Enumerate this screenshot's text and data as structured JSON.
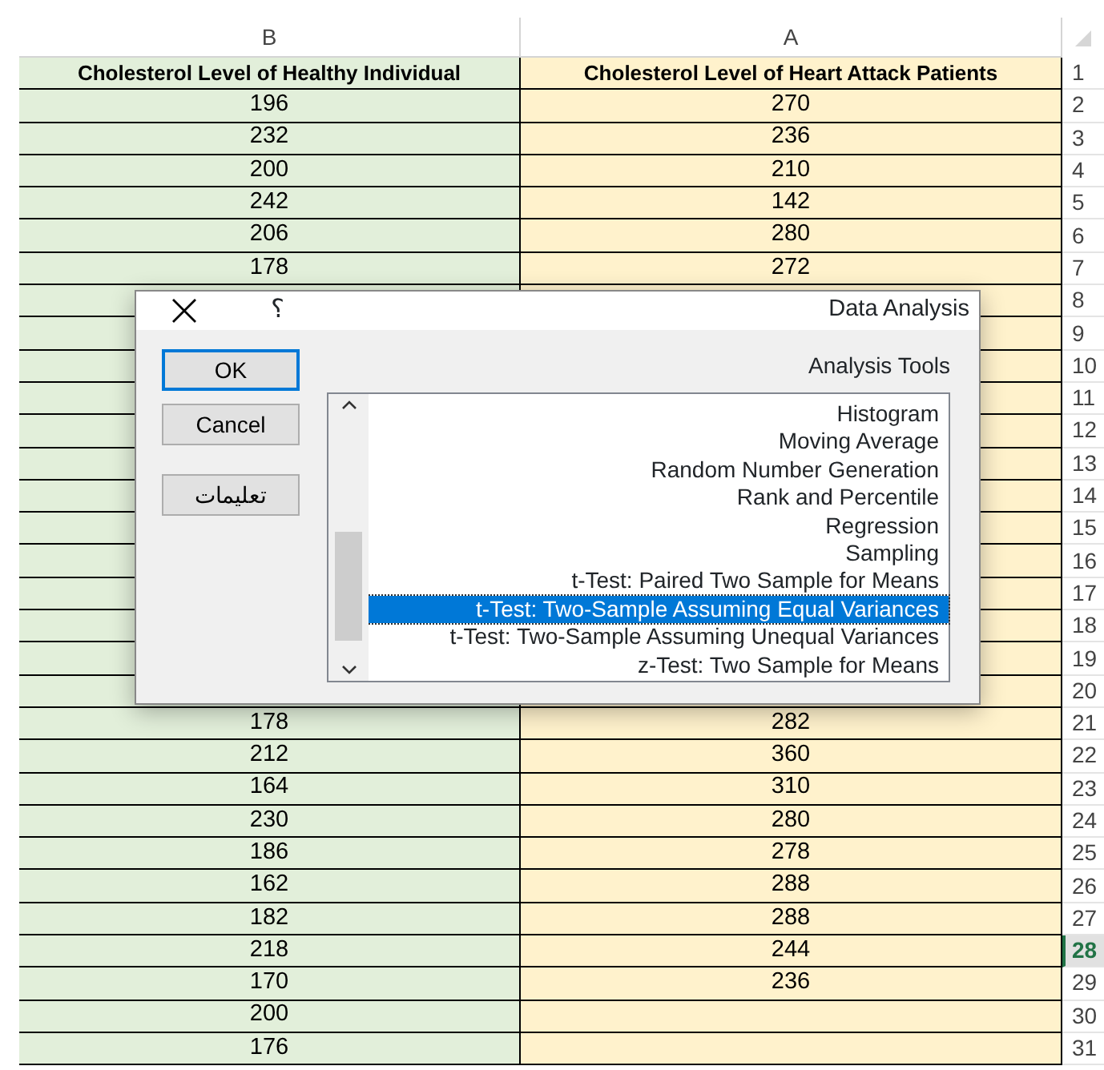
{
  "column_headers": [
    "B",
    "A"
  ],
  "rows": [
    {
      "number": "1",
      "kind": "header",
      "selected": false,
      "b": "Cholesterol Level of Healthy Individual",
      "a": "Cholesterol Level of Heart Attack Patients"
    },
    {
      "number": "2",
      "kind": "data",
      "selected": false,
      "b": "196",
      "a": "270"
    },
    {
      "number": "3",
      "kind": "data",
      "selected": false,
      "b": "232",
      "a": "236"
    },
    {
      "number": "4",
      "kind": "data",
      "selected": false,
      "b": "200",
      "a": "210"
    },
    {
      "number": "5",
      "kind": "data",
      "selected": false,
      "b": "242",
      "a": "142"
    },
    {
      "number": "6",
      "kind": "data",
      "selected": false,
      "b": "206",
      "a": "280"
    },
    {
      "number": "7",
      "kind": "data",
      "selected": false,
      "b": "178",
      "a": "272"
    },
    {
      "number": "8",
      "kind": "data",
      "selected": false
    },
    {
      "number": "9",
      "kind": "data",
      "selected": false
    },
    {
      "number": "10",
      "kind": "data",
      "selected": false
    },
    {
      "number": "11",
      "kind": "data",
      "selected": false
    },
    {
      "number": "12",
      "kind": "data",
      "selected": false
    },
    {
      "number": "13",
      "kind": "data",
      "selected": false
    },
    {
      "number": "14",
      "kind": "data",
      "selected": false
    },
    {
      "number": "15",
      "kind": "data",
      "selected": false
    },
    {
      "number": "16",
      "kind": "data",
      "selected": false
    },
    {
      "number": "17",
      "kind": "data",
      "selected": false
    },
    {
      "number": "18",
      "kind": "data",
      "selected": false
    },
    {
      "number": "19",
      "kind": "data",
      "selected": false
    },
    {
      "number": "20",
      "kind": "data",
      "selected": false
    },
    {
      "number": "21",
      "kind": "data",
      "selected": false,
      "b": "178",
      "a": "282"
    },
    {
      "number": "22",
      "kind": "data",
      "selected": false,
      "b": "212",
      "a": "360"
    },
    {
      "number": "23",
      "kind": "data",
      "selected": false,
      "b": "164",
      "a": "310"
    },
    {
      "number": "24",
      "kind": "data",
      "selected": false,
      "b": "230",
      "a": "280"
    },
    {
      "number": "25",
      "kind": "data",
      "selected": false,
      "b": "186",
      "a": "278"
    },
    {
      "number": "26",
      "kind": "data",
      "selected": false,
      "b": "162",
      "a": "288"
    },
    {
      "number": "27",
      "kind": "data",
      "selected": false,
      "b": "182",
      "a": "288"
    },
    {
      "number": "28",
      "kind": "data",
      "selected": true,
      "b": "218",
      "a": "244"
    },
    {
      "number": "29",
      "kind": "data",
      "selected": false,
      "b": "170",
      "a": "236"
    },
    {
      "number": "30",
      "kind": "data",
      "selected": false,
      "b": "200"
    },
    {
      "number": "31",
      "kind": "data",
      "selected": false,
      "b": "176"
    }
  ],
  "dialog": {
    "title": "Data Analysis",
    "help": "؟",
    "buttons": [
      {
        "label": "OK",
        "focused": true
      },
      {
        "label": "Cancel",
        "focused": false
      },
      {
        "label": "تعليمات",
        "focused": false
      }
    ],
    "list_label": "Analysis Tools",
    "items": [
      {
        "label": "Histogram",
        "selected": false
      },
      {
        "label": "Moving Average",
        "selected": false
      },
      {
        "label": "Random Number Generation",
        "selected": false
      },
      {
        "label": "Rank and Percentile",
        "selected": false
      },
      {
        "label": "Regression",
        "selected": false
      },
      {
        "label": "Sampling",
        "selected": false
      },
      {
        "label": "t-Test: Paired Two Sample for Means",
        "selected": false
      },
      {
        "label": "t-Test: Two-Sample Assuming Equal Variances",
        "selected": true
      },
      {
        "label": "t-Test: Two-Sample Assuming Unequal Variances",
        "selected": false
      },
      {
        "label": "z-Test: Two Sample for Means",
        "selected": false
      }
    ]
  }
}
